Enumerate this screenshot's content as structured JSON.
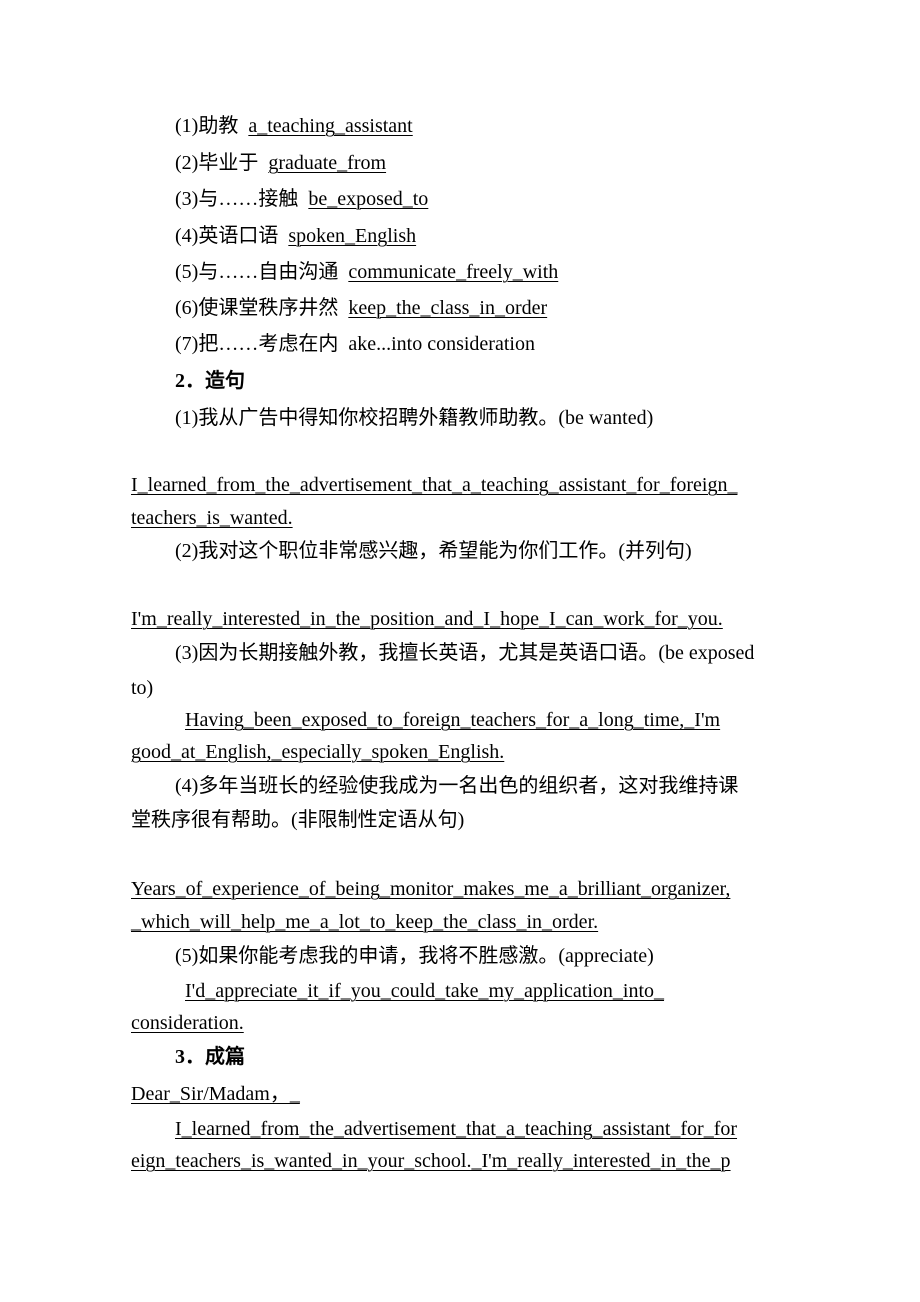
{
  "section1": {
    "items": [
      {
        "cn": "(1)助教",
        "en": "a_teaching_assistant",
        "underlined": true
      },
      {
        "cn": "(2)毕业于",
        "en": "graduate_from",
        "underlined": true
      },
      {
        "cn": "(3)与……接触",
        "en": "be_exposed_to",
        "underlined": true
      },
      {
        "cn": "(4)英语口语",
        "en": "spoken_English",
        "underlined": true
      },
      {
        "cn": "(5)与……自由沟通",
        "en": "communicate_freely_with",
        "underlined": true
      },
      {
        "cn": "(6)使课堂秩序井然",
        "en": "keep_the_class_in_order",
        "underlined": true
      },
      {
        "cn": "(7)把……考虑在内",
        "en": "ake...into consideration",
        "underlined": false
      }
    ]
  },
  "section2": {
    "heading": "2．造句",
    "q1": {
      "prompt": "(1)我从广告中得知你校招聘外籍教师助教。(be wanted)",
      "answer_line1": "I_learned_from_the_advertisement_that_a_teaching_assistant_for_foreign_",
      "answer_line2": "teachers_is_wanted."
    },
    "q2": {
      "prompt": "(2)我对这个职位非常感兴趣，希望能为你们工作。(并列句)",
      "answer_line1": "I'm_really_interested_in_the_position_and_I_hope_I_can_work_for_you."
    },
    "q3": {
      "prompt_line1": "(3)因为长期接触外教，我擅长英语，尤其是英语口语。(be exposed",
      "prompt_line2": "to)",
      "answer_line1": "Having_been_exposed_to_foreign_teachers_for_a_long_time,_I'm",
      "answer_line2": "good_at_English,_especially_spoken_English."
    },
    "q4": {
      "prompt_line1": "(4)多年当班长的经验使我成为一名出色的组织者，这对我维持课",
      "prompt_line2": "堂秩序很有帮助。(非限制性定语从句)",
      "answer_line1": "Years_of_experience_of_being_monitor_makes_me_a_brilliant_organizer,",
      "answer_line2": "_which_will_help_me_a_lot_to_keep_the_class_in_order."
    },
    "q5": {
      "prompt": "(5)如果你能考虑我的申请，我将不胜感激。(appreciate)",
      "answer_line1": "I'd_appreciate_it_if_you_could_take_my_application_into_",
      "answer_line2": "consideration."
    }
  },
  "section3": {
    "heading": "3．成篇",
    "salutation": "Dear_Sir/Madam，_",
    "para_line1": "I_learned_from_the_advertisement_that_a_teaching_assistant_for_for",
    "para_line2": "eign_teachers_is_wanted_in_your_school._I'm_really_interested_in_the_p"
  }
}
